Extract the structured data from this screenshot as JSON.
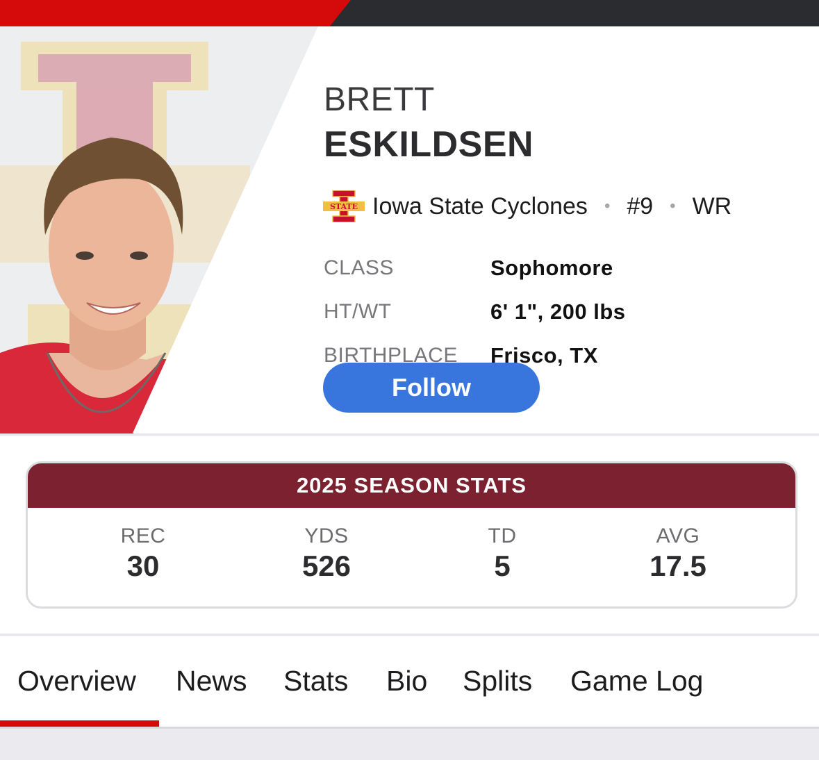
{
  "colors": {
    "brand_red": "#d50a0a",
    "topbar_dark": "#2b2c2f",
    "team_cardinal": "#7c2130",
    "team_gold": "#f1be48",
    "follow_blue": "#3876dd"
  },
  "player": {
    "first_name": "BRETT",
    "last_name": "ESKILDSEN",
    "team": "Iowa State Cyclones",
    "number": "#9",
    "position": "WR",
    "separator": "•"
  },
  "bio": [
    {
      "label": "CLASS",
      "value": "Sophomore"
    },
    {
      "label": "HT/WT",
      "value": "6' 1\", 200 lbs"
    },
    {
      "label": "BIRTHPLACE",
      "value": "Frisco, TX"
    }
  ],
  "follow_label": "Follow",
  "stats": {
    "title": "2025 SEASON STATS",
    "items": [
      {
        "label": "REC",
        "value": "30"
      },
      {
        "label": "YDS",
        "value": "526"
      },
      {
        "label": "TD",
        "value": "5"
      },
      {
        "label": "AVG",
        "value": "17.5"
      }
    ]
  },
  "tabs": [
    {
      "label": "Overview",
      "active": true
    },
    {
      "label": "News"
    },
    {
      "label": "Stats"
    },
    {
      "label": "Bio"
    },
    {
      "label": "Splits"
    },
    {
      "label": "Game Log"
    }
  ]
}
